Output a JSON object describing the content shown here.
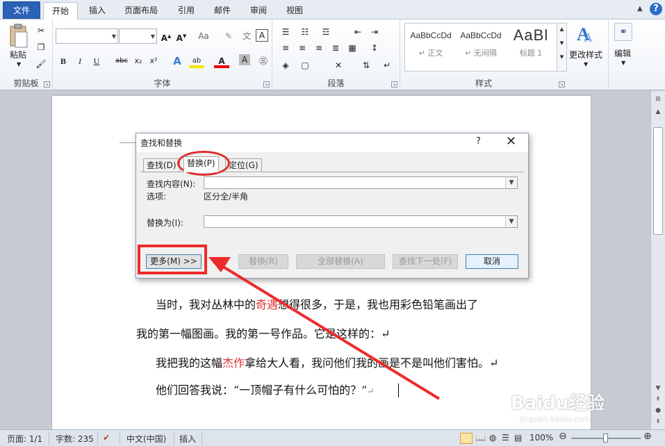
{
  "ribbon_tabs": [
    "文件",
    "开始",
    "插入",
    "页面布局",
    "引用",
    "邮件",
    "审阅",
    "视图"
  ],
  "ribbon": {
    "clipboard": {
      "paste_label": "粘贴",
      "group_label": "剪贴板"
    },
    "font": {
      "group_label": "字体",
      "font_name": "",
      "font_size": ""
    },
    "paragraph": {
      "group_label": "段落"
    },
    "styles": {
      "group_label": "样式",
      "items": [
        {
          "sample": "AaBbCcDd",
          "name": "↵ 正文"
        },
        {
          "sample": "AaBbCcDd",
          "name": "↵ 无间隔"
        },
        {
          "sample": "AaBl",
          "name": "标题 1"
        }
      ],
      "change_styles_label": "更改样式"
    },
    "editing": {
      "label": "编辑"
    }
  },
  "document": {
    "paragraphs": [
      {
        "parts": [
          "当时，我对丛林中的",
          "奇遇",
          "想得很多，于是，我也用彩色铅笔画出了"
        ]
      },
      {
        "parts": [
          "我的第一幅图画。我的第一号作品。它是这样的：↵"
        ]
      },
      {
        "parts": [
          "我把我的这幅",
          "杰作",
          "拿给大人看，我问他们我的画是不是叫他们害怕。↵"
        ]
      },
      {
        "parts": [
          "他们回答我说：“一顶帽子有什么可怕的？”",
          "↵"
        ]
      }
    ]
  },
  "dialog": {
    "title": "查找和替换",
    "help": "?",
    "close": "✕",
    "tabs": [
      "查找(D)",
      "替换(P)",
      "定位(G)"
    ],
    "active_tab": 1,
    "find_label": "查找内容(N):",
    "find_value": "",
    "options_label": "选项:",
    "options_value": "区分全/半角",
    "replace_label": "替换为(I):",
    "replace_value": "",
    "buttons": {
      "more": "更多(M) >>",
      "replace": "替换(R)",
      "replace_all": "全部替换(A)",
      "find_next": "查找下一处(F)",
      "cancel": "取消"
    }
  },
  "status_bar": {
    "page": "页面: 1/1",
    "words": "字数: 235",
    "language": "中文(中国)",
    "mode": "插入",
    "zoom": "100%"
  },
  "watermark": {
    "main": "Baidu经验",
    "sub": "jingyan.baidu.com"
  },
  "colors": {
    "accent": "#2a62b7",
    "highlight_red": "#ee2b2b",
    "text_red": "#d33333"
  }
}
